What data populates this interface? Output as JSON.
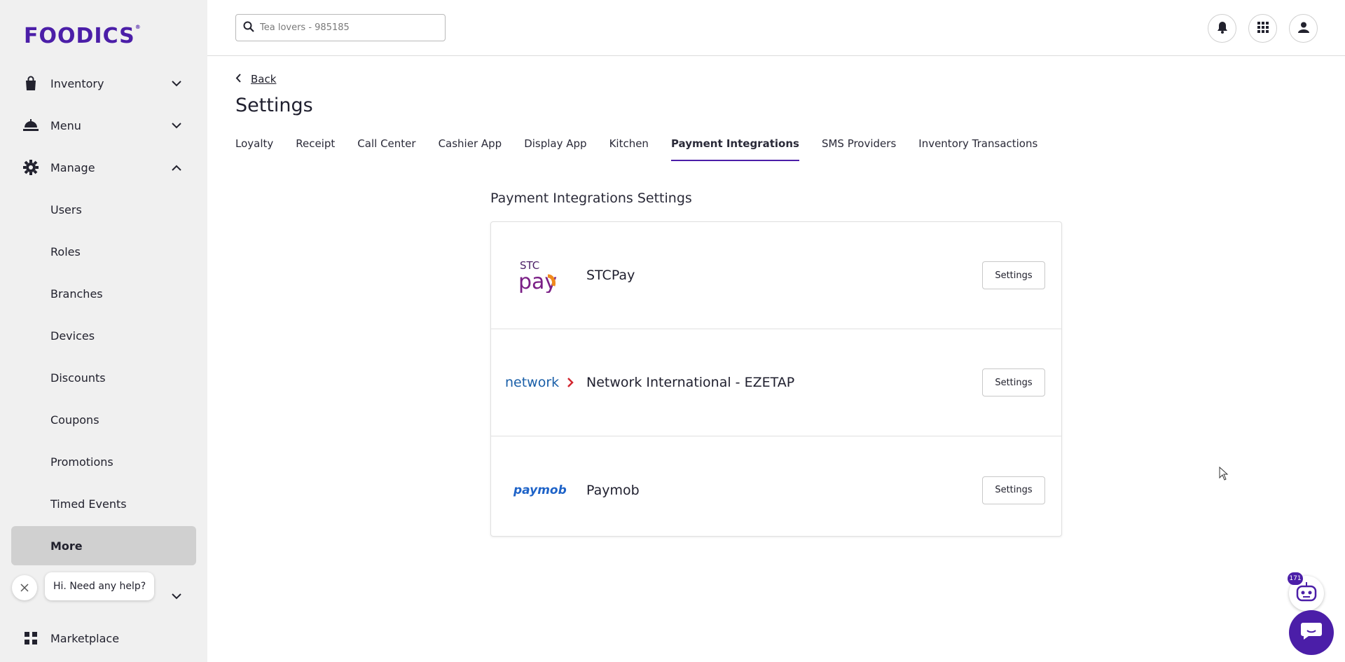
{
  "brand": {
    "name": "FOODICS",
    "mark": "®",
    "color": "#4b1ea8"
  },
  "sidebar": {
    "items": [
      {
        "label": "Inventory",
        "icon": "bag-icon",
        "chevron": "down"
      },
      {
        "label": "Menu",
        "icon": "food-icon",
        "chevron": "down"
      },
      {
        "label": "Manage",
        "icon": "gear-icon",
        "chevron": "up"
      }
    ],
    "sub_items": [
      "Users",
      "Roles",
      "Branches",
      "Devices",
      "Discounts",
      "Coupons",
      "Promotions",
      "Timed Events",
      "More"
    ],
    "active_sub": "More",
    "bottom_items": [
      {
        "label": "Marketplace",
        "icon": "apps-icon"
      }
    ]
  },
  "topbar": {
    "search_placeholder": "Tea lovers - 985185",
    "icons": [
      "bell-icon",
      "grid-icon",
      "user-icon"
    ]
  },
  "page": {
    "back_label": "Back",
    "title": "Settings",
    "tabs": [
      "Loyalty",
      "Receipt",
      "Call Center",
      "Cashier App",
      "Display App",
      "Kitchen",
      "Payment Integrations",
      "SMS Providers",
      "Inventory Transactions"
    ],
    "active_tab": "Payment Integrations"
  },
  "integrations": {
    "section_title": "Payment Integrations Settings",
    "rows": [
      {
        "name": "STCPay",
        "logo": "stcpay-logo",
        "button": "Settings"
      },
      {
        "name": "Network International - EZETAP",
        "logo": "network-logo",
        "button": "Settings"
      },
      {
        "name": "Paymob",
        "logo": "paymob-logo",
        "button": "Settings"
      }
    ]
  },
  "help": {
    "bubble_text": "Hi. Need any help?",
    "badge_count": "171"
  }
}
